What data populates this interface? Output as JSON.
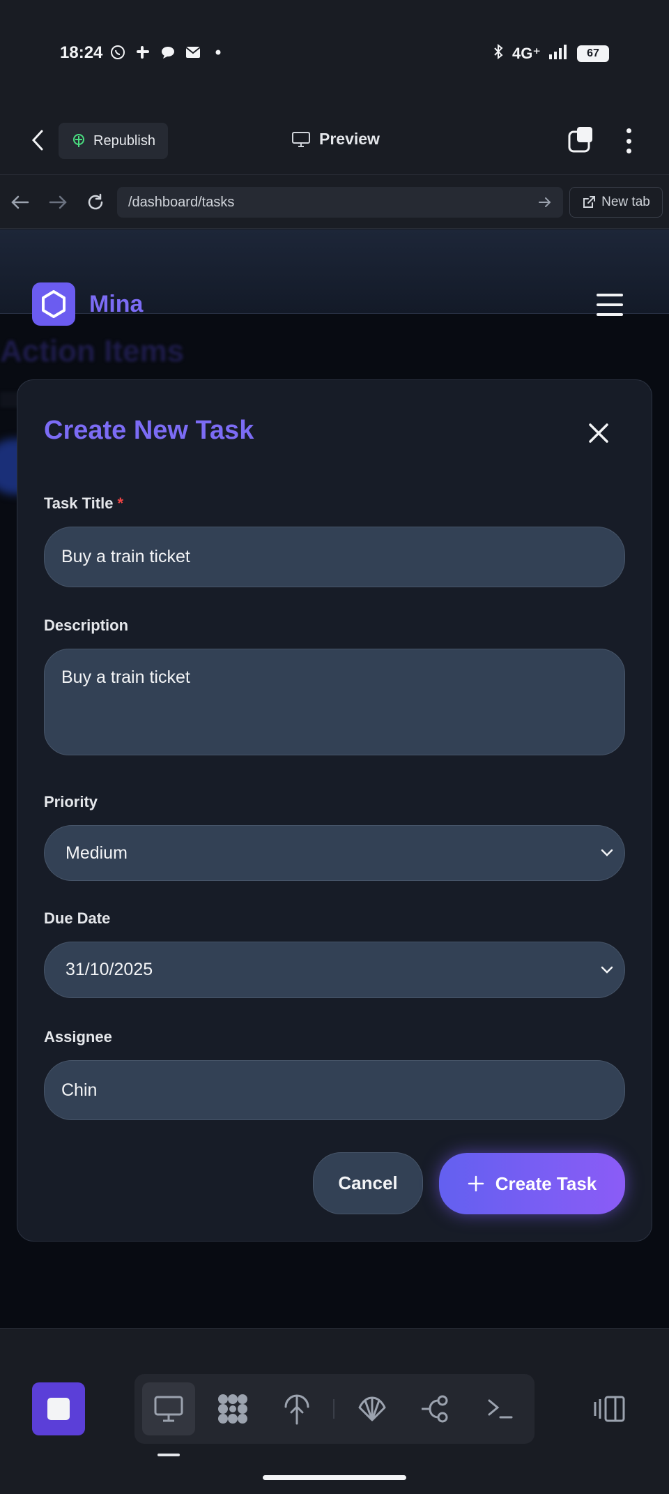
{
  "status_bar": {
    "time": "18:24",
    "network": "4G⁺",
    "battery": "67",
    "notification_icons": [
      "whatsapp-icon",
      "slack-icon",
      "chat-icon",
      "mail-icon",
      "dot-icon"
    ]
  },
  "app_header": {
    "republish_label": "Republish",
    "preview_label": "Preview"
  },
  "browser": {
    "url": "/dashboard/tasks",
    "new_tab_label": "New tab"
  },
  "site": {
    "brand": "Mina",
    "background_heading": "Action Items"
  },
  "modal": {
    "title": "Create New Task",
    "fields": {
      "task_title": {
        "label": "Task Title",
        "required_mark": "*",
        "value": "Buy a train ticket"
      },
      "description": {
        "label": "Description",
        "value": "Buy a train ticket"
      },
      "priority": {
        "label": "Priority",
        "value": "Medium"
      },
      "due_date": {
        "label": "Due Date",
        "value": "31/10/2025"
      },
      "assignee": {
        "label": "Assignee",
        "value": "Chin"
      }
    },
    "cancel_label": "Cancel",
    "create_label": "Create Task"
  },
  "colors": {
    "accent": "#7c6cf5",
    "required": "#ef4444",
    "field_bg": "#334155",
    "modal_bg": "#171c27"
  },
  "bottom_toolbar": {
    "tools": [
      "desktop-icon",
      "apps-icon",
      "deploy-icon",
      "shell-icon",
      "git-icon",
      "terminal-icon"
    ],
    "active_tool": "desktop-icon"
  }
}
